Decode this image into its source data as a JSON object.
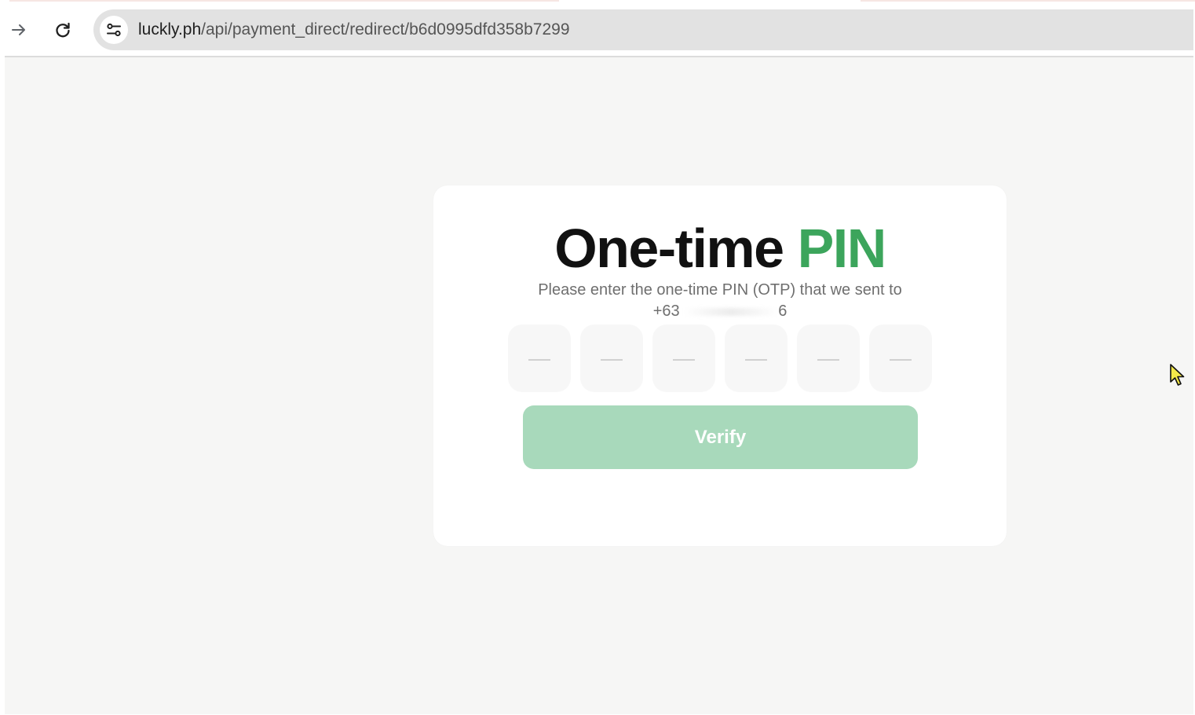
{
  "browser": {
    "forward_icon": "arrow-right-icon",
    "reload_icon": "reload-icon",
    "site_info_icon": "tune-icon",
    "url_host": "luckly.ph",
    "url_path": "/api/payment_direct/redirect/b6d0995dfd358b7299"
  },
  "otp_page": {
    "title_main": "One-time",
    "title_accent": "PIN",
    "instruction": "Please enter the one-time PIN (OTP) that we sent to",
    "phone_prefix": "+63",
    "phone_suffix": "6",
    "digits": [
      {
        "placeholder": "—"
      },
      {
        "placeholder": "—"
      },
      {
        "placeholder": "—"
      },
      {
        "placeholder": "—"
      },
      {
        "placeholder": "—"
      },
      {
        "placeholder": "—"
      }
    ],
    "verify_label": "Verify"
  },
  "colors": {
    "accent": "#3ca55c",
    "button_disabled": "#a8d9bb",
    "page_bg": "#f6f6f5",
    "cursor": "#f5e94a"
  }
}
